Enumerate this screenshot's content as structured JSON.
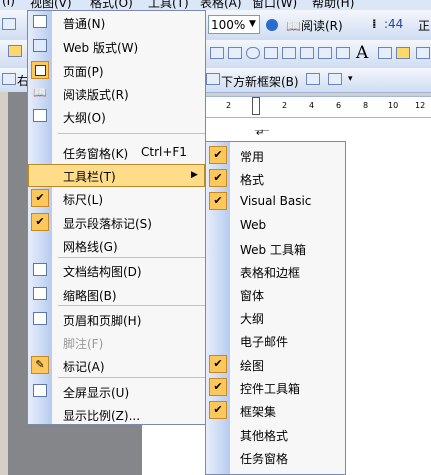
{
  "menubar": [
    "(I)",
    "视图(V)",
    "格式(O)",
    "工具(T)",
    "表格(A)",
    "窗口(W)",
    "帮助(H)"
  ],
  "toolbar1": {
    "zoom": "100%",
    "read_mode": "阅读(R)",
    "style_prefix": "正"
  },
  "toolbar3": {
    "frame_label": "下方新框架(B)",
    "left_label": "右"
  },
  "ruler": [
    "2",
    "2",
    "4",
    "6",
    "8",
    "10",
    "12"
  ],
  "view_menu": {
    "items": [
      {
        "label": "普通(N)",
        "icon": "normal-view-icon",
        "checked": false
      },
      {
        "label": "Web 版式(W)",
        "icon": "web-layout-icon",
        "checked": false
      },
      {
        "label": "页面(P)",
        "icon": "print-layout-icon",
        "checked": false
      },
      {
        "label": "阅读版式(R)",
        "icon": "reading-layout-icon",
        "checked": false
      },
      {
        "label": "大纲(O)",
        "icon": "outline-icon",
        "checked": false
      },
      {
        "label": "任务窗格(K)",
        "shortcut": "Ctrl+F1"
      },
      {
        "label": "工具栏(T)",
        "submenu": true
      },
      {
        "label": "标尺(L)",
        "checked": true
      },
      {
        "label": "显示段落标记(S)",
        "checked": true
      },
      {
        "label": "网格线(G)",
        "checked": false
      },
      {
        "label": "文档结构图(D)",
        "icon": "document-map-icon"
      },
      {
        "label": "缩略图(B)",
        "icon": "thumbnails-icon"
      },
      {
        "label": "页眉和页脚(H)",
        "icon": "header-footer-icon"
      },
      {
        "label": "脚注(F)",
        "disabled": true
      },
      {
        "label": "标记(A)",
        "icon": "markup-icon"
      },
      {
        "label": "全屏显示(U)",
        "icon": "fullscreen-icon"
      },
      {
        "label": "显示比例(Z)..."
      }
    ]
  },
  "toolbars_submenu": {
    "items": [
      {
        "label": "常用",
        "checked": true
      },
      {
        "label": "格式",
        "checked": true
      },
      {
        "label": "Visual Basic",
        "checked": true
      },
      {
        "label": "Web",
        "checked": false
      },
      {
        "label": "Web 工具箱",
        "checked": false
      },
      {
        "label": "表格和边框",
        "checked": false
      },
      {
        "label": "窗体",
        "checked": false
      },
      {
        "label": "大纲",
        "checked": false
      },
      {
        "label": "电子邮件",
        "checked": false
      },
      {
        "label": "绘图",
        "checked": true
      },
      {
        "label": "控件工具箱",
        "checked": true
      },
      {
        "label": "框架集",
        "checked": true
      },
      {
        "label": "其他格式",
        "checked": false
      },
      {
        "label": "任务窗格",
        "checked": false
      }
    ]
  }
}
